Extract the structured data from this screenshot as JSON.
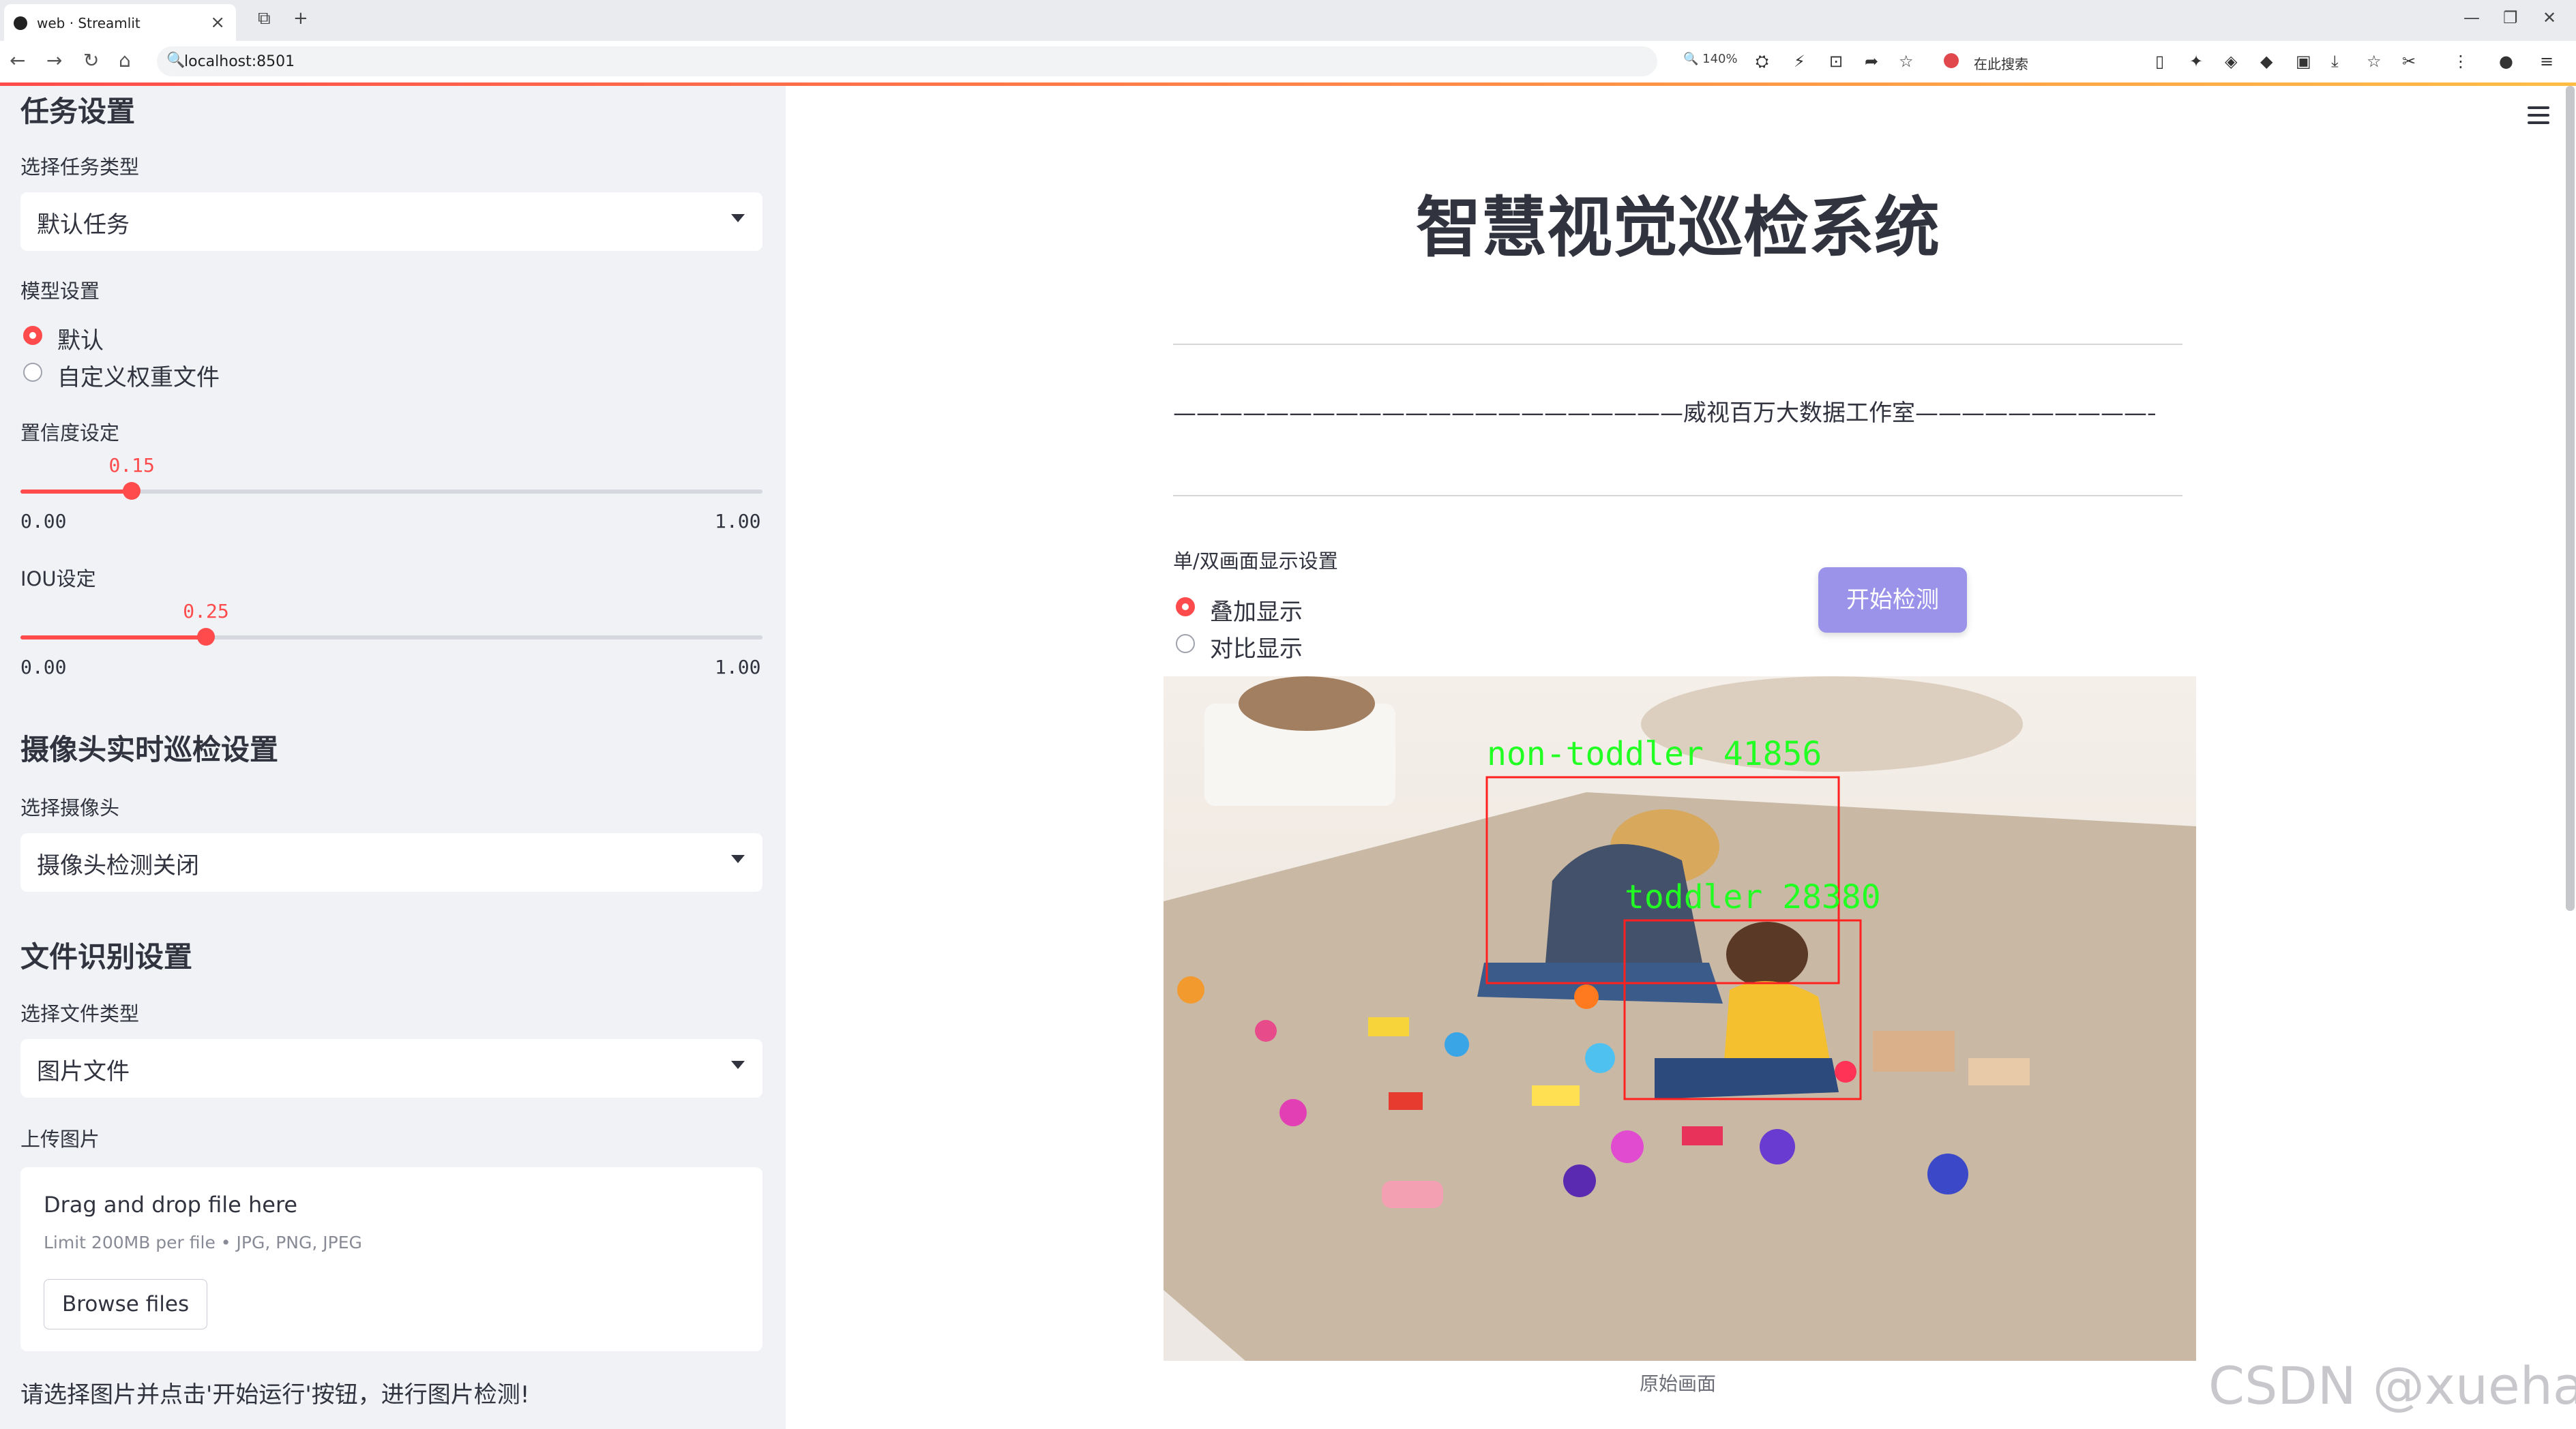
{
  "browser": {
    "tab_title": "web · Streamlit",
    "url": "localhost:8501",
    "zoom": "140%",
    "search_placeholder": "在此搜索"
  },
  "sidebar": {
    "task_header": "任务设置",
    "task_type_label": "选择任务类型",
    "task_type_value": "默认任务",
    "model_label": "模型设置",
    "model_options": [
      "默认",
      "自定义权重文件"
    ],
    "model_selected": 0,
    "confidence": {
      "label": "置信度设定",
      "value": "0.15",
      "min": "0.00",
      "max": "1.00",
      "fraction": 0.15
    },
    "iou": {
      "label": "IOU设定",
      "value": "0.25",
      "min": "0.00",
      "max": "1.00",
      "fraction": 0.25
    },
    "camera_header": "摄像头实时巡检设置",
    "camera_label": "选择摄像头",
    "camera_value": "摄像头检测关闭",
    "file_header": "文件识别设置",
    "file_type_label": "选择文件类型",
    "file_type_value": "图片文件",
    "upload_label": "上传图片",
    "uploader": {
      "drag_text": "Drag and drop file here",
      "limit_text": "Limit 200MB per file • JPG, PNG, JPEG",
      "browse_label": "Browse files"
    },
    "hint": "请选择图片并点击'开始运行'按钮，进行图片检测!"
  },
  "main": {
    "title": "智慧视觉巡检系统",
    "subtitle": "——————————————————————威视百万大数据工作室—————————————————————",
    "display_label": "单/双画面显示设置",
    "display_options": [
      "叠加显示",
      "对比显示"
    ],
    "display_selected": 0,
    "start_button": "开始检测",
    "detections": [
      {
        "label": "non-toddler 41856"
      },
      {
        "label": "toddler 28380"
      }
    ],
    "caption": "原始画面"
  },
  "watermark": "CSDN @xuehaikj",
  "colors": {
    "accent": "#ff4b4b",
    "button": "#9b93ea",
    "box": "#ff2020",
    "box_label": "#22ff22"
  }
}
